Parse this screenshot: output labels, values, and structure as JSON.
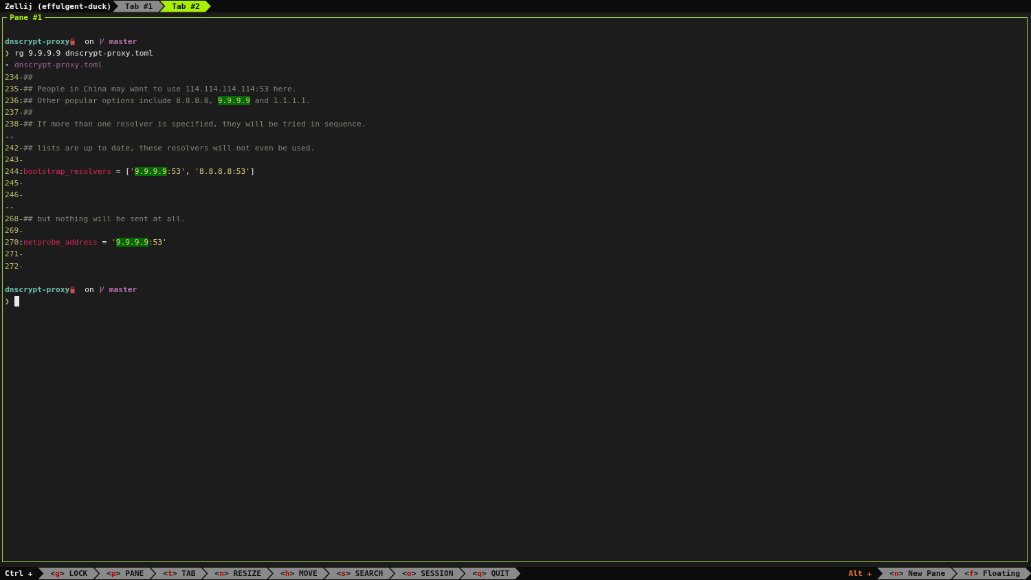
{
  "session": "Zellij (effulgent-duck)",
  "tabs": [
    {
      "label": "Tab #1",
      "selected": false
    },
    {
      "label": "Tab #2",
      "selected": true
    }
  ],
  "pane": {
    "title": "Pane #1",
    "lines": [
      {
        "kind": "prompt",
        "dir": "dnscrypt-proxy",
        "on": "on",
        "branch": "master"
      },
      {
        "kind": "command",
        "symbol": "❯",
        "text": "rg 9.9.9.9 dnscrypt-proxy.toml"
      },
      {
        "kind": "file",
        "bullet": "•",
        "text": "dnscrypt-proxy.toml"
      },
      {
        "kind": "result",
        "number": "234",
        "sep": "-",
        "matched": false,
        "segments": [
          {
            "kind": "comment",
            "text": "##"
          }
        ]
      },
      {
        "kind": "result",
        "number": "235",
        "sep": "-",
        "matched": false,
        "segments": [
          {
            "kind": "comment",
            "text": "## People in China may want to use 114.114.114.114:53 here."
          }
        ]
      },
      {
        "kind": "result",
        "number": "236",
        "sep": ":",
        "matched": true,
        "segments": [
          {
            "kind": "comment",
            "text": "## Other popular options include 8.8.8.8, "
          },
          {
            "kind": "match",
            "text": "9.9.9.9"
          },
          {
            "kind": "comment",
            "text": " and 1.1.1.1."
          }
        ]
      },
      {
        "kind": "result",
        "number": "237",
        "sep": "-",
        "matched": false,
        "segments": [
          {
            "kind": "comment",
            "text": "##"
          }
        ]
      },
      {
        "kind": "result",
        "number": "238",
        "sep": "-",
        "matched": false,
        "segments": [
          {
            "kind": "comment",
            "text": "## If more than one resolver is specified, they will be tried in sequence."
          }
        ]
      },
      {
        "kind": "break",
        "text": "--"
      },
      {
        "kind": "result",
        "number": "242",
        "sep": "-",
        "matched": false,
        "segments": [
          {
            "kind": "comment",
            "text": "## lists are up to date, these resolvers will not even be used."
          }
        ]
      },
      {
        "kind": "result",
        "number": "243",
        "sep": "-",
        "matched": false
      },
      {
        "kind": "result",
        "number": "244",
        "sep": ":",
        "matched": true,
        "segments": [
          {
            "kind": "key",
            "text": "bootstrap_resolvers"
          },
          {
            "kind": "plain",
            "text": " = ["
          },
          {
            "kind": "string",
            "text": "'"
          },
          {
            "kind": "match",
            "text": "9.9.9.9"
          },
          {
            "kind": "string",
            "text": ":53'"
          },
          {
            "kind": "plain",
            "text": ", "
          },
          {
            "kind": "string",
            "text": "'8.8.8.8:53'"
          },
          {
            "kind": "plain",
            "text": "]"
          }
        ]
      },
      {
        "kind": "result",
        "number": "245",
        "sep": "-",
        "matched": false
      },
      {
        "kind": "result",
        "number": "246",
        "sep": "-",
        "matched": false
      },
      {
        "kind": "break",
        "text": "--"
      },
      {
        "kind": "result",
        "number": "268",
        "sep": "-",
        "matched": false,
        "segments": [
          {
            "kind": "comment",
            "text": "## but nothing will be sent at all."
          }
        ]
      },
      {
        "kind": "result",
        "number": "269",
        "sep": "-",
        "matched": false
      },
      {
        "kind": "result",
        "number": "270",
        "sep": ":",
        "matched": true,
        "segments": [
          {
            "kind": "key",
            "text": "netprobe_address"
          },
          {
            "kind": "plain",
            "text": " = "
          },
          {
            "kind": "string",
            "text": "'"
          },
          {
            "kind": "match",
            "text": "9.9.9.9"
          },
          {
            "kind": "string",
            "text": ":53'"
          }
        ]
      },
      {
        "kind": "result",
        "number": "271",
        "sep": "-",
        "matched": false
      },
      {
        "kind": "result",
        "number": "272",
        "sep": "-",
        "matched": false
      },
      {
        "kind": "blank"
      },
      {
        "kind": "prompt",
        "dir": "dnscrypt-proxy",
        "on": "on",
        "branch": "master"
      },
      {
        "kind": "input",
        "symbol": "❯"
      }
    ]
  },
  "status_bar": {
    "modifier": "Ctrl +",
    "shortcuts": [
      {
        "open": "<",
        "key": "g",
        "close": ">",
        "label": "LOCK"
      },
      {
        "open": "<",
        "key": "p",
        "close": ">",
        "label": "PANE"
      },
      {
        "open": "<",
        "key": "t",
        "close": ">",
        "label": "TAB"
      },
      {
        "open": "<",
        "key": "n",
        "close": ">",
        "label": "RESIZE"
      },
      {
        "open": "<",
        "key": "h",
        "close": ">",
        "label": "MOVE"
      },
      {
        "open": "<",
        "key": "s",
        "close": ">",
        "label": "SEARCH"
      },
      {
        "open": "<",
        "key": "o",
        "close": ">",
        "label": "SESSION"
      },
      {
        "open": "<",
        "key": "q",
        "close": ">",
        "label": "QUIT"
      }
    ],
    "alt_modifier": "Alt +",
    "alt_shortcuts": [
      {
        "open": "<",
        "key": "n",
        "close": ">",
        "label": "New Pane"
      },
      {
        "open": "<",
        "key": "f",
        "close": ">",
        "label": "Floating"
      }
    ]
  }
}
